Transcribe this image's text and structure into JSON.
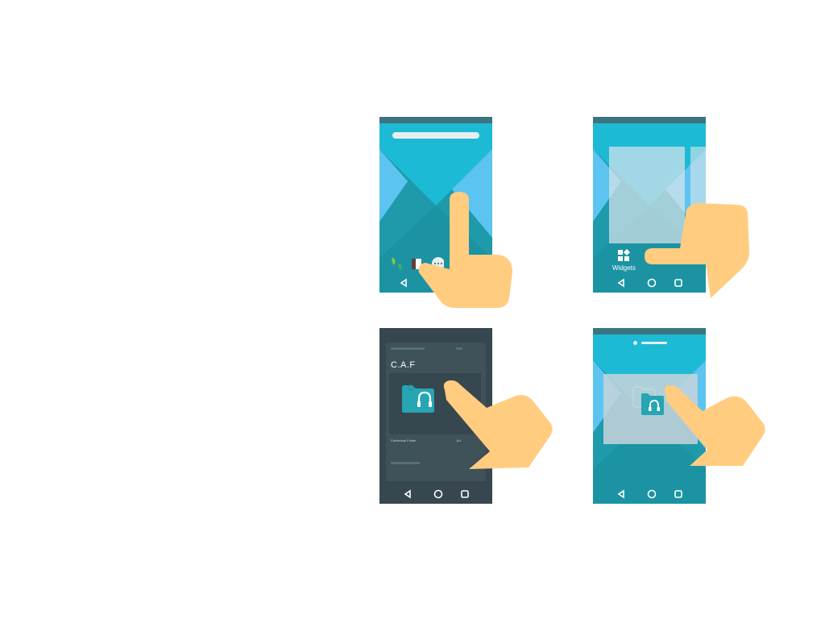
{
  "widgets_label": "Widgets",
  "caf_title": "C.A.F",
  "contextual_folder_label": "Contextual Folder",
  "size_label": "1x1",
  "colors": {
    "teal_dark": "#2297a8",
    "teal_light": "#1fbbd6",
    "sky": "#5bc4f1",
    "status": "#3a7580",
    "drawer": "#37474f",
    "hand": "#ffcc80"
  }
}
